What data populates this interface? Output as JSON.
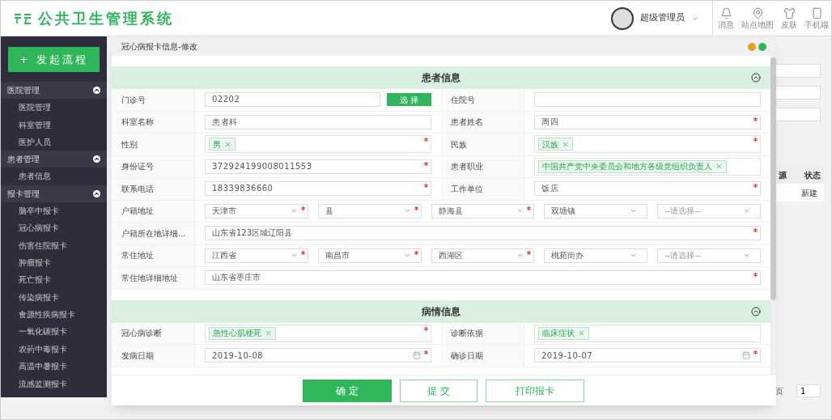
{
  "header": {
    "logo": "公共卫生管理系统",
    "user": "超级管理员",
    "tools": [
      {
        "kind": "bell",
        "label": "消息"
      },
      {
        "kind": "pin",
        "label": "站点地图"
      },
      {
        "kind": "shirt",
        "label": "皮肤"
      },
      {
        "kind": "phone",
        "label": "手机端"
      }
    ]
  },
  "sidebar": {
    "action": "+ 发起流程",
    "groups": [
      {
        "title": "医院管理",
        "expanded": true,
        "items": [
          "医院管理",
          "科室管理",
          "医护人员"
        ]
      },
      {
        "title": "患者管理",
        "expanded": true,
        "items": [
          "患者信息"
        ]
      },
      {
        "title": "报卡管理",
        "expanded": true,
        "items": [
          "脑卒中报卡",
          "冠心病报卡",
          "伤害住院报卡",
          "肿瘤报卡",
          "死亡报卡",
          "传染病报卡",
          "食源性疾病报卡",
          "一氧化碳报卡",
          "农药中毒报卡",
          "高温中暑报卡",
          "流感监测报卡"
        ]
      }
    ]
  },
  "background": {
    "table_columns": [
      "源",
      "状态"
    ],
    "table_cell": "新建",
    "pager_label": "页",
    "pager_value": "1"
  },
  "dialog": {
    "title": "冠心病报卡信息-修改",
    "sections": [
      {
        "title": "患者信息",
        "expanded": true,
        "rows": [
          {
            "kind": "pair",
            "cells": [
              {
                "label": "门诊号",
                "kind": "input",
                "value": "02202",
                "required": false,
                "button": "选 择"
              },
              {
                "label": "住院号",
                "kind": "input",
                "required": false
              }
            ]
          },
          {
            "kind": "pair",
            "cells": [
              {
                "label": "科室名称",
                "kind": "input",
                "value": "患者科",
                "required": false
              },
              {
                "label": "患者姓名",
                "kind": "input",
                "value": "周四",
                "required": true
              }
            ]
          },
          {
            "kind": "pair",
            "cells": [
              {
                "label": "性别",
                "kind": "tags",
                "tags": [
                  "男"
                ],
                "required": true
              },
              {
                "label": "民族",
                "kind": "tags",
                "tags": [
                  "汉族"
                ],
                "required": true
              }
            ]
          },
          {
            "kind": "pair",
            "cells": [
              {
                "label": "身份证号",
                "kind": "input",
                "value": "372924199008011553",
                "required": true
              },
              {
                "label": "患者职业",
                "kind": "tags",
                "tags": [
                  "中国共产党中央委员会和地方各级党组织负责人"
                ],
                "required": false
              }
            ]
          },
          {
            "kind": "pair",
            "cells": [
              {
                "label": "联系电话",
                "kind": "input",
                "value": "18339836660",
                "required": true
              },
              {
                "label": "工作单位",
                "kind": "input",
                "value": "饭店",
                "required": true
              }
            ]
          },
          {
            "kind": "selects",
            "label": "户籍地址",
            "selects": [
              {
                "value": "天津市",
                "required": true,
                "placeholder": false
              },
              {
                "value": "县",
                "required": true,
                "placeholder": false
              },
              {
                "value": "静海县",
                "required": true,
                "placeholder": false
              },
              {
                "value": "双塘镇",
                "required": false,
                "placeholder": false
              },
              {
                "value": "--请选择--",
                "required": false,
                "placeholder": true
              }
            ]
          },
          {
            "kind": "full",
            "label": "户籍所在地详细...",
            "value": "山东省123区城辽阳县",
            "required": true
          },
          {
            "kind": "selects",
            "label": "常住地址",
            "selects": [
              {
                "value": "江西省",
                "required": true,
                "placeholder": false
              },
              {
                "value": "南昌市",
                "required": true,
                "placeholder": false
              },
              {
                "value": "西湖区",
                "required": true,
                "placeholder": false
              },
              {
                "value": "桃苑街办",
                "required": false,
                "placeholder": false
              },
              {
                "value": "--请选择--",
                "required": false,
                "placeholder": true
              }
            ]
          },
          {
            "kind": "full",
            "label": "常住地详细地址",
            "value": "山东省枣庄市",
            "required": true
          }
        ]
      },
      {
        "title": "病情信息",
        "expanded": true,
        "rows": [
          {
            "kind": "pair",
            "cells": [
              {
                "label": "冠心病诊断",
                "kind": "tags",
                "tags": [
                  "急性心肌梗死"
                ],
                "required": true
              },
              {
                "label": "诊断依据",
                "kind": "tags",
                "tags": [
                  "临床症状"
                ],
                "required": false
              }
            ]
          },
          {
            "kind": "pair",
            "cells": [
              {
                "label": "发病日期",
                "kind": "date",
                "value": "2019-10-08",
                "required": true
              },
              {
                "label": "确诊日期",
                "kind": "date",
                "value": "2019-10-07",
                "required": true
              }
            ]
          }
        ]
      }
    ],
    "buttons": [
      {
        "kind": "primary",
        "label": "确 定"
      },
      {
        "kind": "outline",
        "label": "提 交"
      },
      {
        "kind": "outline",
        "label": "打印报卡"
      }
    ]
  }
}
